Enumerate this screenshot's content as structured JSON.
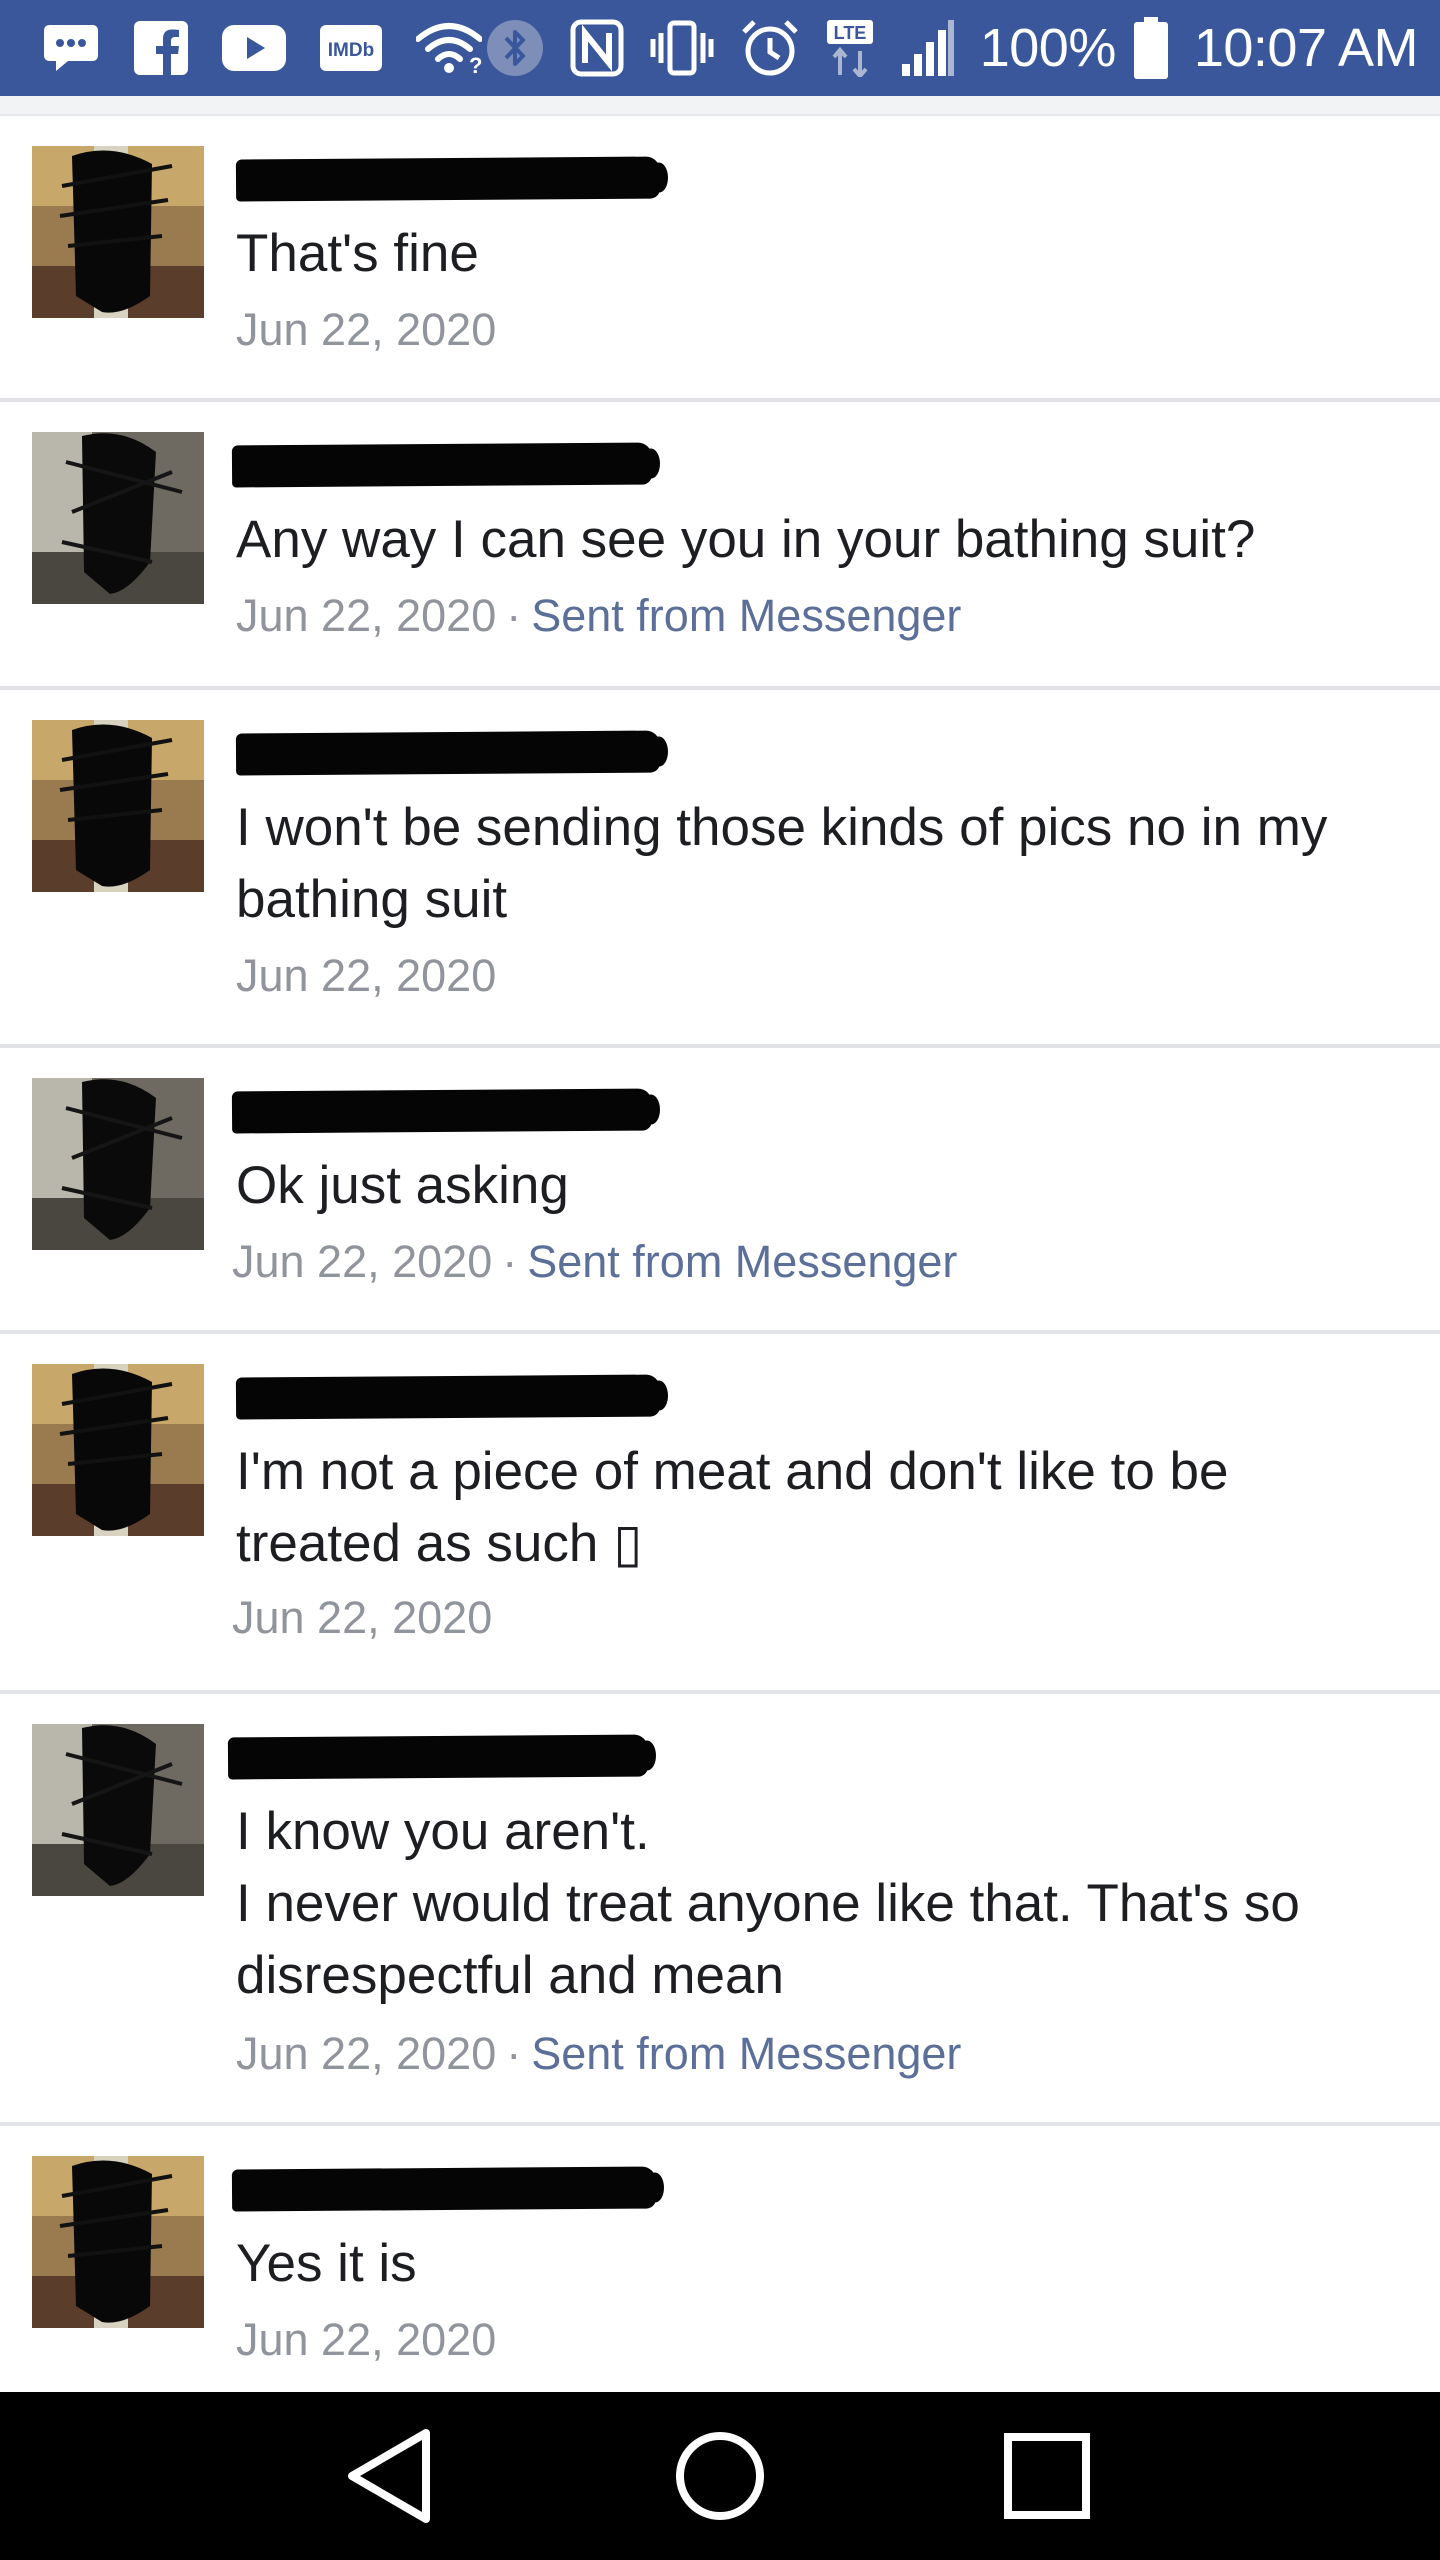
{
  "status_bar": {
    "icons": [
      "messenger-icon",
      "facebook-icon",
      "youtube-icon",
      "imdb-icon",
      "wifi-icon",
      "bluetooth-icon",
      "nfc-icon",
      "vibrate-icon",
      "alarm-icon",
      "lte-icon",
      "signal-icon",
      "battery-icon"
    ],
    "imdb_label": "IMDb",
    "lte_label": "LTE",
    "battery_percent": "100%",
    "time": "10:07 AM",
    "bar_color": "#39579a"
  },
  "messages": [
    {
      "text": "That's fine",
      "date": "Jun 22, 2020",
      "source": ""
    },
    {
      "text": "Any way I can see you in your bathing suit?",
      "date": "Jun 22, 2020",
      "source": "Sent from Messenger"
    },
    {
      "text": "I won't be sending those kinds of pics no in my bathing suit",
      "date": "Jun 22, 2020",
      "source": ""
    },
    {
      "text": "Ok just asking",
      "date": "Jun 22, 2020",
      "source": "Sent from Messenger"
    },
    {
      "text": "I'm not a piece of meat and don't like to be treated as such ▯",
      "date": "Jun 22, 2020",
      "source": ""
    },
    {
      "text": "I know you aren't.\nI never would treat anyone like that. That's so disrespectful and mean",
      "date": "Jun 22, 2020",
      "source": "Sent from Messenger"
    },
    {
      "text": "Yes it is",
      "date": "Jun 22, 2020",
      "source": ""
    }
  ],
  "meta_separator": "·",
  "colors": {
    "link": "#5b6f99",
    "meta": "#90949c",
    "divider": "#e1e3e7"
  },
  "nav_bar": {
    "buttons": [
      "back-icon",
      "home-icon",
      "recents-icon"
    ]
  }
}
